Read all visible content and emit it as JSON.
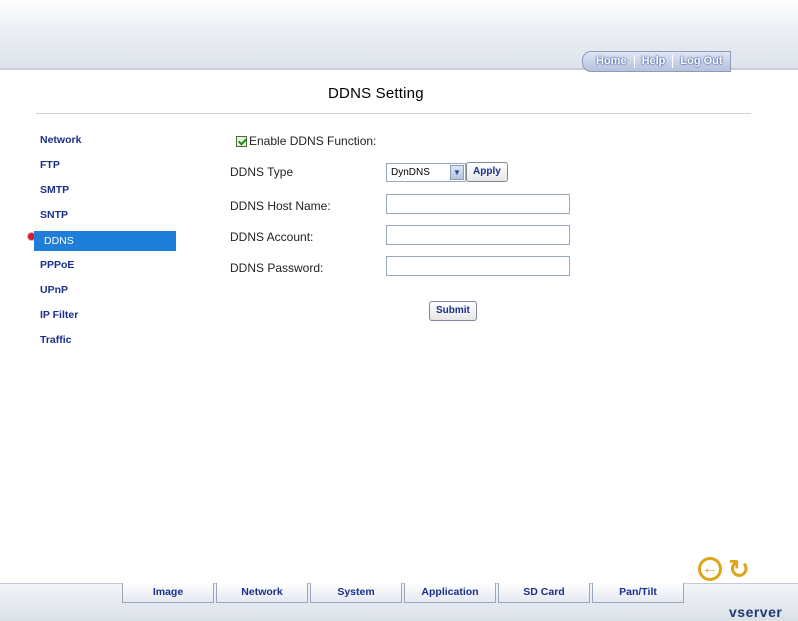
{
  "header": {
    "nav": [
      "Home",
      "Help",
      "Log Out"
    ]
  },
  "page": {
    "title": "DDNS Setting"
  },
  "sidebar": {
    "items": [
      {
        "label": "Network",
        "active": false
      },
      {
        "label": "FTP",
        "active": false
      },
      {
        "label": "SMTP",
        "active": false
      },
      {
        "label": "SNTP",
        "active": false
      },
      {
        "label": "DDNS",
        "active": true
      },
      {
        "label": "PPPoE",
        "active": false
      },
      {
        "label": "UPnP",
        "active": false
      },
      {
        "label": "IP Filter",
        "active": false
      },
      {
        "label": "Traffic",
        "active": false
      }
    ]
  },
  "form": {
    "enable_label": "Enable DDNS Function:",
    "enable_checked": true,
    "type_label": "DDNS Type",
    "type_value": "DynDNS",
    "apply_label": "Apply",
    "host_label": "DDNS Host Name:",
    "host_value": "",
    "account_label": "DDNS Account:",
    "account_value": "",
    "password_label": "DDNS Password:",
    "password_value": "",
    "submit_label": "Submit"
  },
  "footer": {
    "tabs": [
      "Image",
      "Network",
      "System",
      "Application",
      "SD Card",
      "Pan/Tilt"
    ],
    "brand": "vserver"
  },
  "colors": {
    "accent": "#1f7fd8",
    "nav_text": "#1b2f8c",
    "icon": "#e0a41a",
    "bullet": "#d41c2e"
  },
  "icons": [
    "back-arrow-icon",
    "refresh-icon",
    "checkbox-checked-icon",
    "chevron-down-icon",
    "bullet-icon"
  ]
}
